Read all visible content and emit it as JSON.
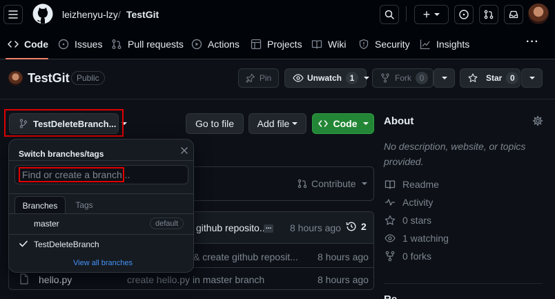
{
  "header": {
    "owner": "leizhenyu-lzy",
    "separator": "/",
    "repo": "TestGit",
    "plus_label": "+"
  },
  "nav": {
    "tabs": [
      {
        "label": "Code",
        "icon": "code-icon"
      },
      {
        "label": "Issues",
        "icon": "issue-opened-icon"
      },
      {
        "label": "Pull requests",
        "icon": "git-pull-request-icon"
      },
      {
        "label": "Actions",
        "icon": "play-icon"
      },
      {
        "label": "Projects",
        "icon": "table-icon"
      },
      {
        "label": "Wiki",
        "icon": "book-icon"
      },
      {
        "label": "Security",
        "icon": "shield-icon"
      },
      {
        "label": "Insights",
        "icon": "graph-icon"
      }
    ],
    "more_label": "···"
  },
  "repo": {
    "name": "TestGit",
    "visibility": "Public",
    "pin_label": "Pin",
    "watch_label": "Unwatch",
    "watch_count": "1",
    "fork_label": "Fork",
    "fork_count": "0",
    "star_label": "Star",
    "star_count": "0"
  },
  "toolbar": {
    "branch_label": "TestDeleteBranch...",
    "goto_file": "Go to file",
    "add_file": "Add file",
    "code_label": "Code"
  },
  "contribute_label": "Contribute",
  "commit_bar": {
    "message": "github reposito...",
    "ellipsis": "...",
    "time": "8 hours ago",
    "commit_count": "2"
  },
  "files": [
    {
      "name": "",
      "message": "& create github reposit...",
      "time": "8 hours ago"
    },
    {
      "name": "hello.py",
      "message": "create hello.py in master branch",
      "time": "8 hours ago"
    }
  ],
  "dropdown": {
    "title": "Switch branches/tags",
    "placeholder": "Find or create a branch...",
    "tab_branches": "Branches",
    "tab_tags": "Tags",
    "branches": [
      {
        "name": "master",
        "badge": "default",
        "selected": false
      },
      {
        "name": "TestDeleteBranch",
        "badge": "",
        "selected": true
      }
    ],
    "view_all": "View all branches"
  },
  "about": {
    "title": "About",
    "description": "No description, website, or topics provided.",
    "items": [
      {
        "label": "Readme",
        "icon": "book-icon"
      },
      {
        "label": "Activity",
        "icon": "pulse-icon"
      },
      {
        "label": "0 stars",
        "icon": "star-icon"
      },
      {
        "label": "1 watching",
        "icon": "eye-icon"
      },
      {
        "label": "0 forks",
        "icon": "repo-forked-icon"
      }
    ],
    "next_heading": "Re"
  },
  "colors": {
    "accent_green": "#238636",
    "link_blue": "#4493f8",
    "highlight_red": "#e00000",
    "tab_underline": "#f78166"
  }
}
